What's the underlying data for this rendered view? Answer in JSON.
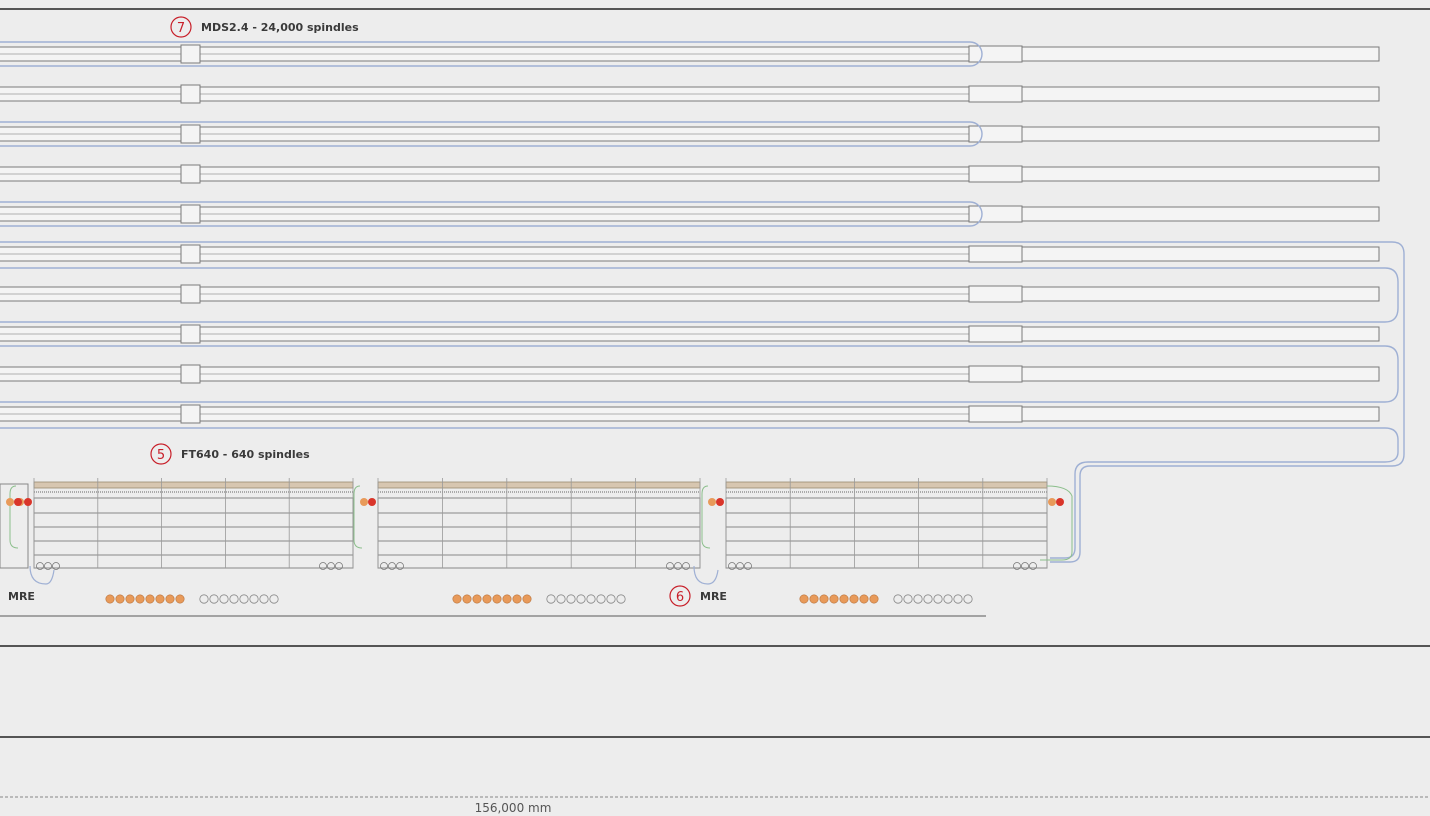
{
  "labels": {
    "mds": {
      "number": "7",
      "text": "MDS2.4 - 24,000 spindles"
    },
    "ft": {
      "number": "5",
      "text": "FT640 - 640 spindles"
    },
    "mre_left": {
      "text": "MRE"
    },
    "mre_right": {
      "number": "6",
      "text": "MRE"
    }
  },
  "dimension": {
    "text": "156,000 mm"
  },
  "layout": {
    "mds_row_count": 10,
    "ft_machine_count": 3,
    "bobbin_groups": 3,
    "filled_bobbins_per_group": 8,
    "empty_bobbins_per_group": 8
  },
  "colors": {
    "background": "#ededed",
    "frame_line": "#555555",
    "rail": "#7a7a7a",
    "loop_blue": "#9fb0d4",
    "loop_green": "#8cbf8c",
    "callout_red": "#c8202a",
    "bobbin_orange": "#e89a5a",
    "machine_red": "#d9352a"
  }
}
